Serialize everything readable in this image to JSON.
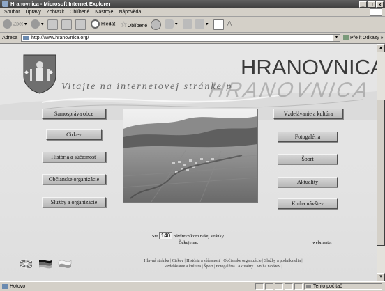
{
  "window": {
    "title": "Hranovnica - Microsoft Internet Explorer",
    "buttons": [
      "_",
      "□",
      "×"
    ]
  },
  "menu": [
    "Soubor",
    "Úpravy",
    "Zobrazit",
    "Oblíbené",
    "Nástroje",
    "Nápověda"
  ],
  "toolbar": {
    "back": "Zpět",
    "search": "Hledat",
    "favorites": "Oblíbené"
  },
  "address": {
    "label": "Adresa",
    "url": "http://www.hranovnica.org/",
    "go": "Přejít",
    "links": "Odkazy"
  },
  "site": {
    "brand": "HRANOVNICA",
    "welcome": "Vitajte na internetovej stránke p",
    "left_nav": [
      "Samospráva obce",
      "Cirkev",
      "História a súčasnosť",
      "Občianske organizácie",
      "Služby a organizácie"
    ],
    "right_nav": [
      "Vzdelávanie a kultúra",
      "Fotogaléria",
      "Šport",
      "Aktuality",
      "Kniha návštev"
    ],
    "visitors_prefix": "Ste",
    "visitors_count": "140",
    "visitors_suffix": "návštevníkom našej stránky.",
    "thanks": "Ďakujeme.",
    "webmaster": "webmaster",
    "footer_line1": "Hlavná stránka | Cirkev | História a súčasnosť | Občianske organizácie | Služby a podnikatelia |",
    "footer_line2": "Vzdelávanie a kultúra | Šport | Fotogaléria | Aktuality | Kniha návštev |"
  },
  "status": {
    "left": "Hotovo",
    "zone": "Tento počítač"
  }
}
